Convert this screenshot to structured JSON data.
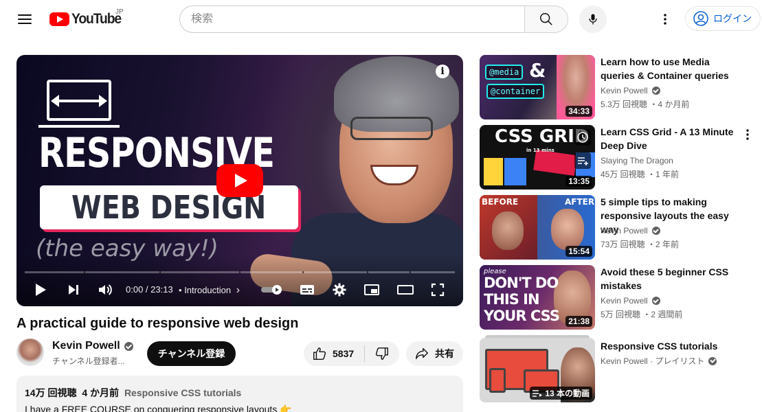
{
  "header": {
    "logo_text": "YouTube",
    "region": "JP",
    "search_placeholder": "検索",
    "login_label": "ログイン"
  },
  "player": {
    "thumb_line1": "RESPONSIVE",
    "thumb_line2": "WEB DESIGN",
    "thumb_line3": "(the easy way!)",
    "info_label": "i",
    "time": "0:00 / 23:13",
    "chapter": "Introduction",
    "chapter_separator": "•",
    "chapter_arrow": "›"
  },
  "video": {
    "title": "A practical guide to responsive web design",
    "channel_name": "Kevin Powell",
    "subscribers": "チャンネル登録者...",
    "subscribe_label": "チャンネル登録",
    "like_count": "5837",
    "share_label": "共有"
  },
  "description": {
    "views": "14万 回視聴",
    "age": "4 か月前",
    "tag": "Responsive CSS tutorials",
    "text": "I have a FREE COURSE on conquering responsive layouts 👉"
  },
  "sidebar": {
    "items": [
      {
        "title": "Learn how to use Media queries & Container queries",
        "channel": "Kevin Powell",
        "stats": "5.3万 回視聴 ・4 か月前",
        "duration": "34:33",
        "thumb_text": [
          "@media",
          "&",
          "@container"
        ]
      },
      {
        "title": "Learn CSS Grid - A 13 Minute Deep Dive",
        "channel": "Slaying The Dragon",
        "stats": "45万 回視聴 ・1 年前",
        "duration": "13:35",
        "thumb_text": [
          "CSS GRID",
          "in 13 mins"
        ]
      },
      {
        "title": "5 simple tips to making responsive layouts the easy way",
        "channel": "Kevin Powell",
        "stats": "73万 回視聴 ・2 年前",
        "duration": "15:54",
        "thumb_text": [
          "BEFORE",
          "AFTER"
        ]
      },
      {
        "title": "Avoid these 5 beginner CSS mistakes",
        "channel": "Kevin Powell",
        "stats": "5万 回視聴 ・2 週間前",
        "duration": "21:38",
        "thumb_text": [
          "please",
          "DON'T DO",
          "THIS IN",
          "YOUR CSS"
        ]
      },
      {
        "title": "Responsive CSS tutorials",
        "channel": "Kevin Powell · プレイリスト",
        "playlist_count": "13 本の動画"
      }
    ]
  },
  "colors": {
    "brand_red": "#ff0000",
    "link_blue": "#065fd4",
    "text_primary": "#0f0f0f",
    "text_secondary": "#606060",
    "chip_bg": "#f2f2f2"
  }
}
